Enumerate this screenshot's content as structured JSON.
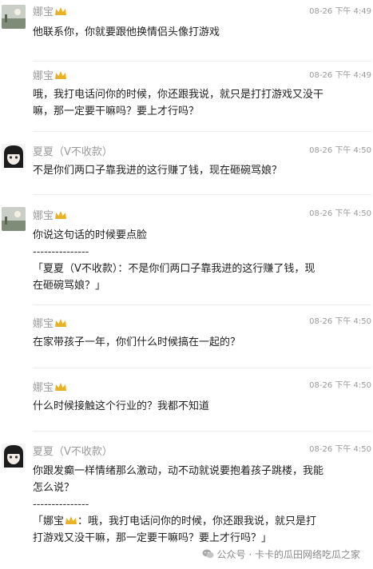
{
  "messages": [
    {
      "user": "娜宝",
      "crown": true,
      "avatar": "scenery",
      "time": "08-26 下午 4:49",
      "text": "他联系你，你就要跟他换情侣头像打游戏"
    },
    {
      "user": "娜宝",
      "crown": true,
      "avatar": "",
      "time": "08-26 下午 4:49",
      "text_l1": "哦，我打电话问你的时候，你还跟我说，就只是打打游戏又没干",
      "text_l2": "嘛，那一定要干嘛吗？要上才行吗？"
    },
    {
      "user": "夏夏（V不收款）",
      "crown": false,
      "avatar": "anime",
      "time": "08-26 下午 4:50",
      "text": "不是你们两口子靠我进的这行赚了钱，现在砸碗骂娘？"
    },
    {
      "user": "娜宝",
      "crown": true,
      "avatar": "scenery",
      "time": "08-26 下午 4:50",
      "text": "你说这句话的时候要点脸",
      "separator": "---------------",
      "quote_l1": "「夏夏（V不收款）：不是你们两口子靠我进的这行赚了钱，现",
      "quote_l2": "在砸碗骂娘？」"
    },
    {
      "user": "娜宝",
      "crown": true,
      "avatar": "",
      "time": "08-26 下午 4:50",
      "text": "在家带孩子一年，你们什么时候搞在一起的？"
    },
    {
      "user": "娜宝",
      "crown": true,
      "avatar": "",
      "time": "08-26 下午 4:50",
      "text": "什么时候接触这个行业的？我都不知道"
    },
    {
      "user": "夏夏（V不收款）",
      "crown": false,
      "avatar": "anime",
      "time": "08-26 下午 4:50",
      "text_l1": "你跟发癫一样情绪那么激动，动不动就说要抱着孩子跳楼，我能",
      "text_l2": "怎么说？",
      "separator": "---------------",
      "quote_prefix": "「娜宝",
      "quote_l1": "：哦，我打电话问你的时候，你还跟我说，就只是打",
      "quote_l2": "打游戏又没干嘛，那一定要干嘛吗？要上才行吗？」"
    }
  ],
  "watermark": "公众号 · 卡卡的瓜田网络吃瓜之家",
  "colors": {
    "meta": "#9a9a9a",
    "text": "#222222",
    "crown": "#e8b326",
    "divider": "#ececec"
  }
}
